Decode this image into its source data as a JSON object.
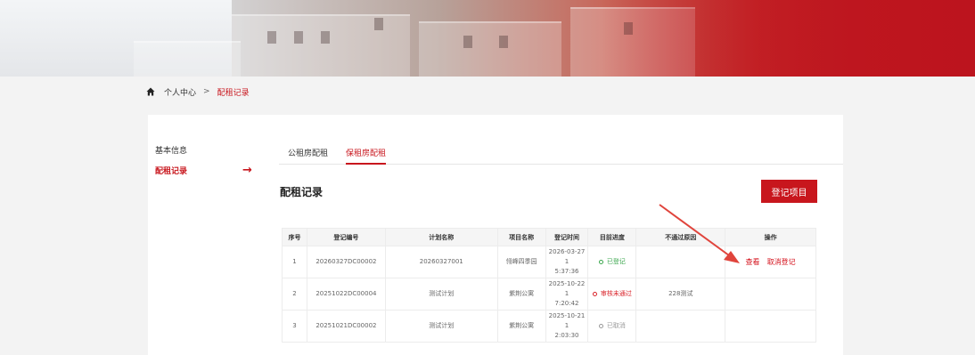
{
  "breadcrumb": {
    "home": "个人中心",
    "separator": ">",
    "current": "配租记录"
  },
  "sidebar": {
    "items": [
      {
        "label": "基本信息"
      },
      {
        "label": "配租记录",
        "active": true
      }
    ],
    "arrow": "→"
  },
  "tabs": [
    {
      "label": "公租房配租"
    },
    {
      "label": "保租房配租",
      "active": true
    }
  ],
  "section": {
    "title": "配租记录",
    "register_button": "登记项目"
  },
  "table": {
    "columns": [
      "序号",
      "登记编号",
      "计划名称",
      "项目名称",
      "登记时间",
      "目前进度",
      "不通过原因",
      "操作"
    ],
    "rows": [
      {
        "index": "1",
        "reg_no": "20260327DC00002",
        "plan": "20260327001",
        "project": "翎峰四季园",
        "time1": "2026-03-27 1",
        "time2": "5:37:36",
        "status": "已登记",
        "status_color": "#3aa64c",
        "reason": "",
        "actions": [
          "查看",
          "取消登记"
        ]
      },
      {
        "index": "2",
        "reg_no": "20251022DC00004",
        "plan": "测试计划",
        "project": "紫荆公寓",
        "time1": "2025-10-22 1",
        "time2": "7:20:42",
        "status": "审核未通过",
        "status_color": "#d9232a",
        "reason": "228测试",
        "actions": []
      },
      {
        "index": "3",
        "reg_no": "20251021DC00002",
        "plan": "测试计划",
        "project": "紫荆公寓",
        "time1": "2025-10-21 1",
        "time2": "2:03:30",
        "status": "已取消",
        "status_color": "#999999",
        "reason": "",
        "actions": []
      }
    ]
  },
  "colors": {
    "accent": "#c8161d"
  }
}
